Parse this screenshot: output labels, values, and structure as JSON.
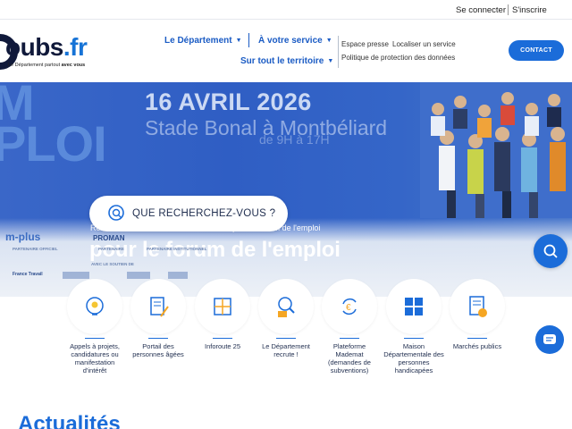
{
  "topbar": {
    "login": "Se connecter",
    "register": "S'inscrire"
  },
  "logo": {
    "name": "oubs",
    "tld": ".fr",
    "tagline": "Le Département partout",
    "tagline_bold": "avec vous"
  },
  "nav": {
    "departement": "Le Département",
    "service": "À votre service",
    "territoire": "Sur tout le territoire"
  },
  "utility": {
    "presse": "Espace presse",
    "localiser": "Localiser un service",
    "privacy": "Politique de protection des données"
  },
  "contact_label": "CONTACT",
  "hero": {
    "art_left": "M\nPLOI",
    "date": "16 AVRIL 2026",
    "venue": "Stade Bonal à Montbéliard",
    "venue_hours": "de 9H à 17H",
    "kicker": "Rendez-vous le 16 avril au stade Bonal pour le forum de l'emploi",
    "title": "pour le forum de l'emploi",
    "search_label": "QUE RECHERCHEZ-VOUS ?"
  },
  "partners": {
    "mplus": "m-plus",
    "mplus_caption": "PARTENAIRE OFFICIEL",
    "proman": "PROMAN",
    "proman_caption": "PARTENAIRE",
    "inst_caption": "PARTENAIRE INSTITUTIONNEL",
    "support_caption": "AVEC LE SOUTIEN DE",
    "francetravail": "France Travail"
  },
  "quick_links": [
    {
      "label": "Appels à projets, candidatures ou manifestation d'intérêt",
      "icon": "lightbulb-head-icon"
    },
    {
      "label": "Portail des personnes âgées",
      "icon": "document-pen-icon"
    },
    {
      "label": "Inforoute 25",
      "icon": "road-map-icon"
    },
    {
      "label": "Le Département recrute !",
      "icon": "recruitment-search-icon"
    },
    {
      "label": "Plateforme Mademat (demandes de subventions)",
      "icon": "euro-cycle-icon"
    },
    {
      "label": "Maison Départementale des personnes handicapées",
      "icon": "accessibility-icon"
    },
    {
      "label": "Marchés publics",
      "icon": "contract-euro-icon"
    }
  ],
  "section_title": "Actualités",
  "colors": {
    "accent": "#1b6cd9",
    "navy": "#10193a",
    "hero": "#2f5ec4"
  }
}
